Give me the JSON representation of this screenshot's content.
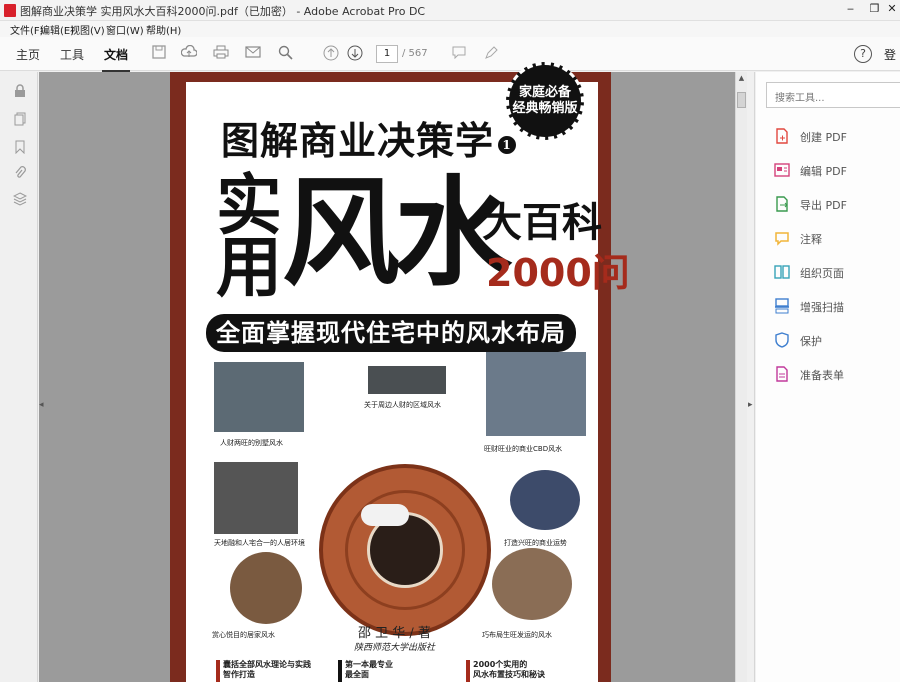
{
  "window": {
    "title": "图解商业决策学 实用风水大百科2000问.pdf（已加密） - Adobe Acrobat Pro DC",
    "controls": [
      "‒",
      "❐",
      "✕"
    ]
  },
  "menu": [
    "文件(F)",
    "编辑(E)",
    "视图(V)",
    "窗口(W)",
    "帮助(H)"
  ],
  "toolbar": {
    "tabs": [
      "主页",
      "工具",
      "文档"
    ],
    "active_tab": "文档",
    "page_current": "1",
    "page_total": "/ 567",
    "help": "?",
    "signin": "登"
  },
  "right_pane": {
    "search_placeholder": "搜索工具...",
    "tools": [
      {
        "label": "创建 PDF",
        "icon": "create-pdf-icon",
        "color": "#e1483f"
      },
      {
        "label": "编辑 PDF",
        "icon": "edit-pdf-icon",
        "color": "#d4417a"
      },
      {
        "label": "导出 PDF",
        "icon": "export-pdf-icon",
        "color": "#3a9a4e"
      },
      {
        "label": "注释",
        "icon": "comment-icon",
        "color": "#f2b53a"
      },
      {
        "label": "组织页面",
        "icon": "organize-pages-icon",
        "color": "#37a3b8"
      },
      {
        "label": "增强扫描",
        "icon": "enhance-scan-icon",
        "color": "#3f7fcf"
      },
      {
        "label": "保护",
        "icon": "protect-icon",
        "color": "#3f7fcf"
      },
      {
        "label": "准备表单",
        "icon": "prepare-form-icon",
        "color": "#c1399b"
      }
    ]
  },
  "cover": {
    "series": "图解商业决策学",
    "series_num": "1",
    "title_small": "实用",
    "title_big": "风水",
    "title_right": "大百科",
    "title_num": "2000问",
    "banner": "全面掌握现代住宅中的风水布局",
    "seal_line1": "家庭必备",
    "seal_line2": "经典畅销版",
    "captions": [
      "人财两旺的别墅风水",
      "关于周边人财的区域风水",
      "旺财旺业的商业CBD风水",
      "天地融和人宅合一的人居环境",
      "打造兴旺的商业运势",
      "赏心悦目的居家风水",
      "巧布局生旺发运的风水"
    ],
    "author": "邵 卫 华 / 著",
    "publisher": "陕西师范大学出版社",
    "bottom1": "囊括全部风水理论与实践\n智作打造",
    "bottom2": "第一本最专业\n最全面",
    "bottom3": "2000个实用的\n风水布置技巧和秘诀"
  }
}
